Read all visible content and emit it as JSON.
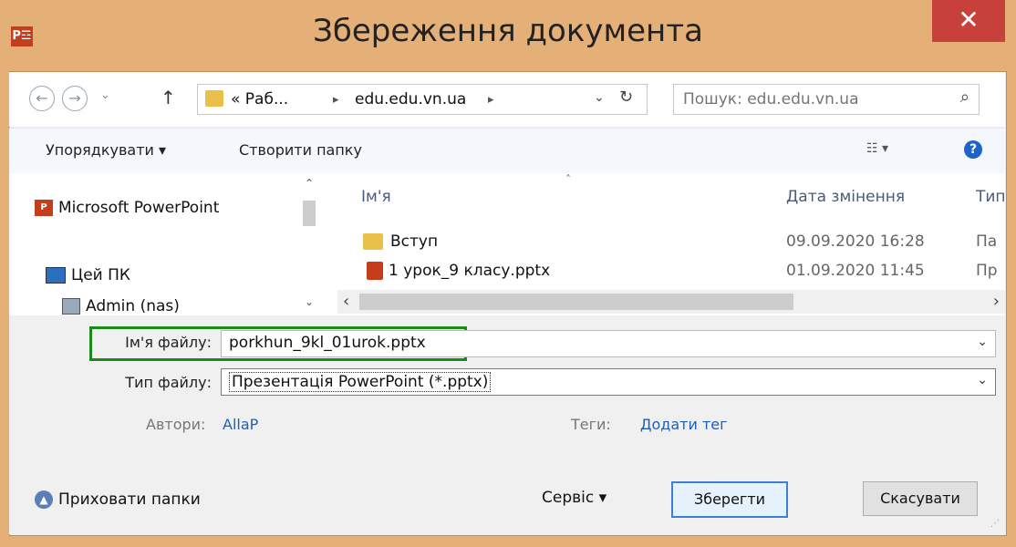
{
  "window": {
    "title": "Збереження документа",
    "app_icon": "P☲",
    "close_glyph": "✕"
  },
  "nav": {
    "back_glyph": "←",
    "forward_glyph": "→",
    "recent_glyph": "⌄",
    "up_glyph": "↑",
    "breadcrumb": [
      "« Раб...",
      "edu.edu.vn.ua"
    ],
    "crumb_sep": "▸",
    "dropdown_glyph": "⌄",
    "refresh_glyph": "↻",
    "search_placeholder": "Пошук: edu.edu.vn.ua",
    "search_icon": "⌕"
  },
  "toolbar": {
    "organize_label": "Упорядкувати ▾",
    "new_folder_label": "Створити папку",
    "view_glyph": "☷ ▾",
    "help_glyph": "?"
  },
  "navpane": {
    "items": [
      {
        "label": "Microsoft PowerPoint",
        "icon": "powerpoint-icon"
      },
      {
        "label": "Цей ПК",
        "icon": "computer-icon"
      },
      {
        "label": "Admin (nas)",
        "icon": "network-drive-icon"
      }
    ],
    "scroll_up": "⌃",
    "scroll_down": "⌄"
  },
  "filelist": {
    "columns": [
      "Ім'я",
      "Дата змінення",
      "Тип"
    ],
    "sort_glyph": "˄",
    "rows": [
      {
        "name": "Вступ",
        "date": "09.09.2020 16:28",
        "type": "Па",
        "icon": "folder-icon"
      },
      {
        "name": "1 урок_9 класу.pptx",
        "date": "01.09.2020 11:45",
        "type": "Пр",
        "icon": "pptx-file-icon"
      }
    ],
    "scroll_left": "‹",
    "scroll_right": "›"
  },
  "form": {
    "filename_label": "Ім'я файлу:",
    "filename_value": "porkhun_9kl_01urok.pptx",
    "filetype_label": "Тип файлу:",
    "filetype_value": "Презентація PowerPoint (*.pptx)",
    "dropdown_glyph": "⌄",
    "authors_label": "Автори:",
    "authors_value": "AllaP",
    "tags_label": "Теги:",
    "tags_value": "Додати тег"
  },
  "footer": {
    "hide_folders_label": "Приховати папки",
    "hide_folders_glyph": "▲",
    "service_label": "Сервіс ▾",
    "save_label": "Зберегти",
    "cancel_label": "Скасувати",
    "grip_glyph": "⋰"
  },
  "colors": {
    "frame": "#e4b078",
    "close": "#c7403a",
    "highlight": "#1a8a1a",
    "link": "#1f5fb8"
  }
}
